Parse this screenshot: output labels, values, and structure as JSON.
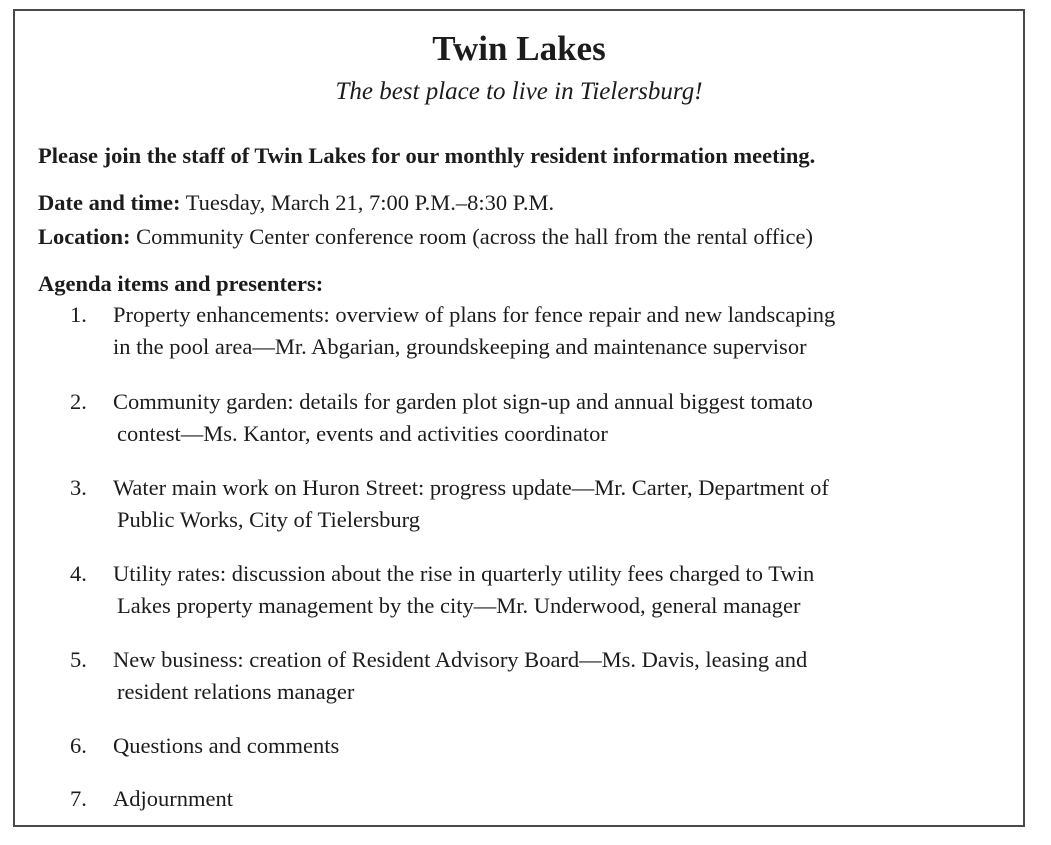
{
  "notice": {
    "title": "Twin Lakes",
    "subtitle": "The best place to live in Tielersburg!",
    "invitation": "Please join the staff of Twin Lakes for our monthly resident information meeting.",
    "date_label": "Date and time:",
    "date_value": " Tuesday, March 21, 7:00 P.M.–8:30 P.M.",
    "location_label": "Location:",
    "location_value": " Community Center conference room (across the hall from the rental office)",
    "agenda_heading": "Agenda items and presenters:",
    "agenda": [
      {
        "num": "1.",
        "line1": "Property enhancements: overview of plans for fence repair and new landscaping",
        "line2": "in the pool area—Mr. Abgarian, groundskeeping and maintenance supervisor"
      },
      {
        "num": "2.",
        "line1": "Community garden: details for garden plot sign-up and annual biggest tomato",
        "line2": "contest—Ms. Kantor, events and activities coordinator"
      },
      {
        "num": "3.",
        "line1": "Water main work on Huron Street: progress update—Mr. Carter, Department of",
        "line2": "Public Works, City of Tielersburg"
      },
      {
        "num": "4.",
        "line1": "Utility rates: discussion about the rise in quarterly utility fees charged to Twin",
        "line2": "Lakes property management by the city—Mr. Underwood, general manager"
      },
      {
        "num": "5.",
        "line1": "New business: creation of Resident Advisory Board—Ms. Davis, leasing and",
        "line2": "resident relations manager"
      },
      {
        "num": "6.",
        "line1": "Questions and comments"
      },
      {
        "num": "7.",
        "line1": "Adjournment"
      }
    ]
  }
}
